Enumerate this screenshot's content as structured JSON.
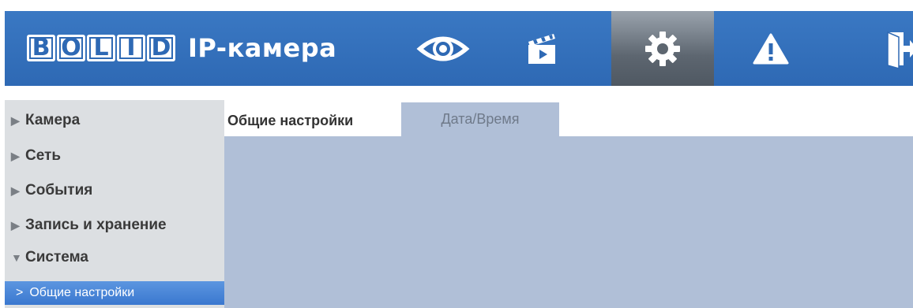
{
  "header": {
    "logo_letters": [
      "B",
      "O",
      "L",
      "I",
      "D"
    ],
    "app_title": "IP-камера",
    "nav": [
      {
        "icon": "eye-icon",
        "active": false
      },
      {
        "icon": "clapperboard-icon",
        "active": false
      },
      {
        "icon": "gear-icon",
        "active": true
      },
      {
        "icon": "warning-icon",
        "active": false
      },
      {
        "icon": "exit-door-icon",
        "active": false
      }
    ]
  },
  "sidebar": {
    "items": [
      {
        "label": "Камера",
        "expanded": false
      },
      {
        "label": "Сеть",
        "expanded": false
      },
      {
        "label": "События",
        "expanded": false
      },
      {
        "label": "Запись и хранение",
        "expanded": false
      },
      {
        "label": "Система",
        "expanded": true
      }
    ],
    "subitem": {
      "label": "Общие настройки",
      "selected": true
    }
  },
  "tabs": [
    {
      "label": "Общие настройки",
      "active": true
    },
    {
      "label": "Дата/Время",
      "active": false
    }
  ],
  "colors": {
    "header_bg": "#2e69b4",
    "active_nav_bg": "#5d6670",
    "sidebar_bg": "#dcdfe2",
    "selected_bg": "#3a78cf",
    "content_bg": "#b0bfd7"
  }
}
